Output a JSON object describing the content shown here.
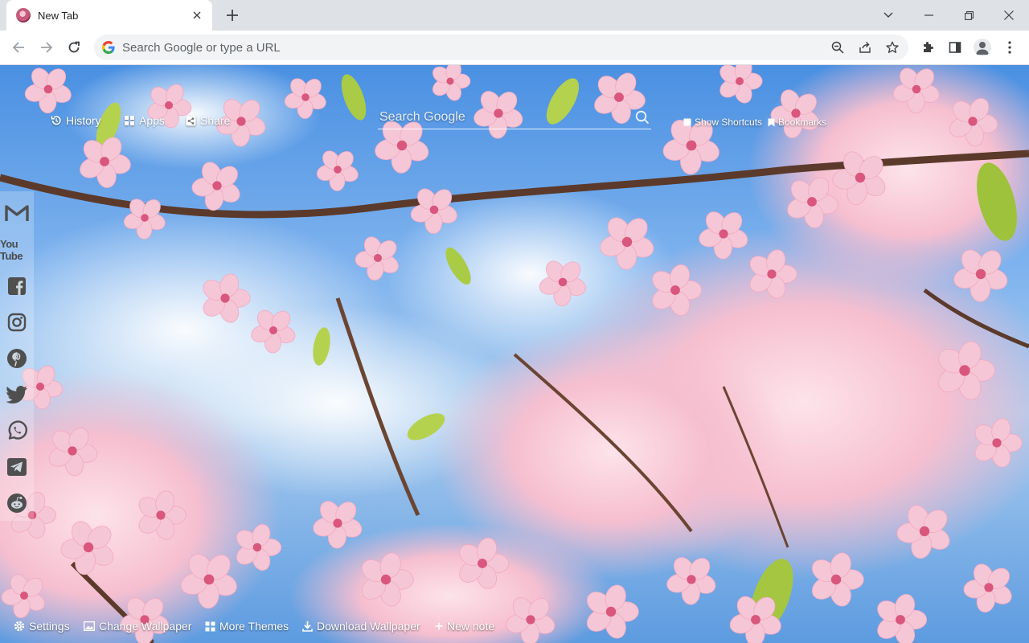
{
  "tab": {
    "title": "New Tab",
    "favicon": "cherry-blossom-favicon"
  },
  "omnibox": {
    "placeholder": "Search Google or type a URL"
  },
  "ntp": {
    "top_links": [
      {
        "label": "History",
        "icon": "history-icon"
      },
      {
        "label": "Apps",
        "icon": "apps-grid-icon"
      },
      {
        "label": "Share",
        "icon": "share-icon"
      }
    ],
    "search": {
      "placeholder": "Search Google"
    },
    "right_links": [
      {
        "label": "Show Shortcuts",
        "icon": "shortcuts-icon"
      },
      {
        "label": "Bookmarks",
        "icon": "bookmark-icon"
      }
    ],
    "social": [
      {
        "name": "gmail-icon"
      },
      {
        "name": "youtube-icon",
        "label": "You Tube"
      },
      {
        "name": "facebook-icon"
      },
      {
        "name": "instagram-icon"
      },
      {
        "name": "pinterest-icon"
      },
      {
        "name": "twitter-icon"
      },
      {
        "name": "whatsapp-icon"
      },
      {
        "name": "telegram-icon"
      },
      {
        "name": "reddit-icon"
      }
    ],
    "bottom_links": [
      {
        "label": "Settings",
        "icon": "gear-icon"
      },
      {
        "label": "Change Wallpaper",
        "icon": "image-icon"
      },
      {
        "label": "More Themes",
        "icon": "grid-icon"
      },
      {
        "label": "Download Wallpaper",
        "icon": "download-icon"
      },
      {
        "label": "New note",
        "icon": "plus-icon"
      }
    ]
  },
  "colors": {
    "sky": "#4a90e2",
    "blossom": "#f5c6d6",
    "blossom_center": "#d9567d",
    "branch": "#5b3a2b",
    "leaf": "#b5d24f",
    "chrome_bg": "#dee1e6"
  }
}
